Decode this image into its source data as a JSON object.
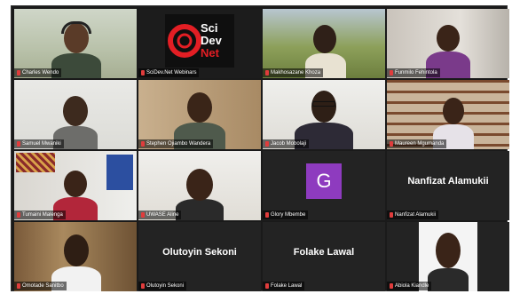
{
  "participants": [
    {
      "name": "Charles Wendo"
    },
    {
      "name": "SciDev.Net Webinars"
    },
    {
      "name": "Makhosazane Khoza"
    },
    {
      "name": "Funmilo Fehintola"
    },
    {
      "name": "Samuel Mwaniki"
    },
    {
      "name": "Stephen Ojiambo Wandera"
    },
    {
      "name": "Jacob Mobolaji"
    },
    {
      "name": "Maureen Mgumanda"
    },
    {
      "name": "Tumaini Malenga"
    },
    {
      "name": "UWASE Aline"
    },
    {
      "name": "Glory Mbembe"
    },
    {
      "name": "Nanfizat Alamukii"
    },
    {
      "name": "Omotade Sanitbo"
    },
    {
      "name": "Olutoyin Sekoni"
    },
    {
      "name": "Folake Lawal"
    },
    {
      "name": "Abiola Kiandle"
    }
  ],
  "tiles_text": {
    "logo_line1": "Sci",
    "logo_line2": "Dev",
    "logo_line3": "Net",
    "glory_initial": "G",
    "nanfizat_display": "Nanfizat Alamukii",
    "olutoyin_display": "Olutoyin Sekoni",
    "folake_display": "Folake Lawal"
  },
  "colors": {
    "active_speaker_border": "#b9d84a",
    "muted_mic": "#e03c3c",
    "avatar_bg": "#8e3bbf",
    "logo_red": "#e31e24"
  },
  "icons": {
    "mic": "mic-muted-icon"
  }
}
